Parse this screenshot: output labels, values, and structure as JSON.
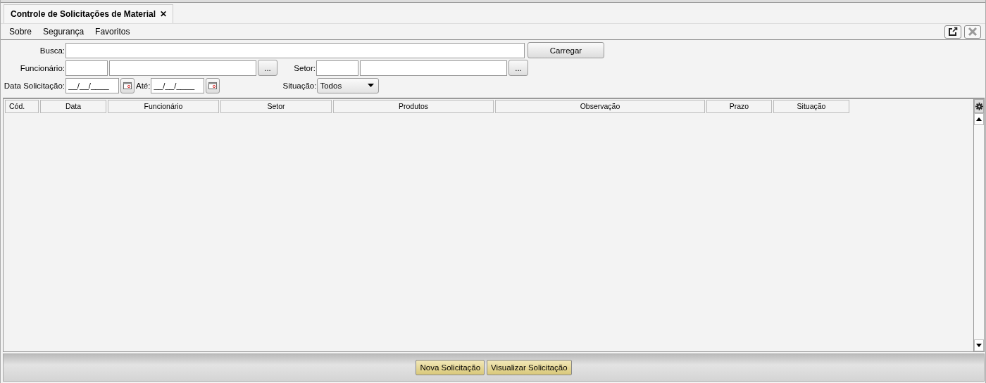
{
  "tab": {
    "title": "Controle de Solicitações de Material",
    "close": "✕",
    "selected": true
  },
  "menu": [
    "Sobre",
    "Segurança",
    "Favoritos"
  ],
  "filters": {
    "busca": {
      "label": "Busca:"
    },
    "carregar": "Carregar",
    "funcionario": {
      "label": "Funcionário:",
      "button": "..."
    },
    "setor": {
      "label": "Setor:",
      "button": "..."
    },
    "data_solicitacao": {
      "label": "Data Solicitação:",
      "value": "__/__/____"
    },
    "ate": {
      "label": "Até:",
      "value": "__/__/____"
    },
    "situacao": {
      "label": "Situação:",
      "value": "Todos"
    }
  },
  "table": {
    "columns": [
      "Cód.",
      "Data",
      "Funcionário",
      "Setor",
      "Produtos",
      "Observação",
      "Prazo",
      "Situação"
    ]
  },
  "buttons": [
    "Nova Solicitação",
    "Visualizar Solicitação"
  ]
}
